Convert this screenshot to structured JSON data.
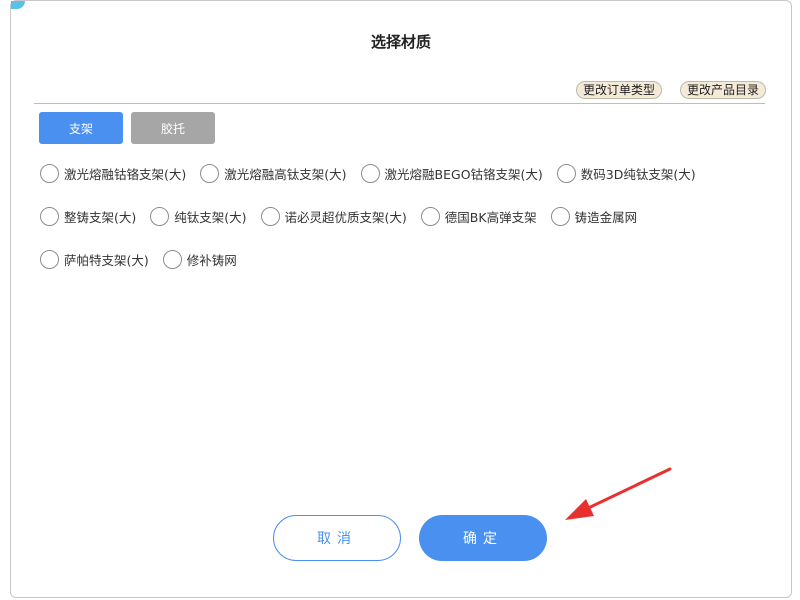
{
  "dialog": {
    "title": "选择材质",
    "top_actions": {
      "change_order_type": "更改订单类型",
      "change_product_catalog": "更改产品目录"
    },
    "tabs": [
      {
        "label": "支架",
        "active": true
      },
      {
        "label": "胶托",
        "active": false
      }
    ],
    "options": [
      "激光熔融钴铬支架(大)",
      "激光熔融高钛支架(大)",
      "激光熔融BEGO钴铬支架(大)",
      "数码3D纯钛支架(大)",
      "整铸支架(大)",
      "纯钛支架(大)",
      "诺必灵超优质支架(大)",
      "德国BK高弹支架",
      "铸造金属网",
      "萨帕特支架(大)",
      "修补铸网"
    ],
    "footer": {
      "cancel_label": "取消",
      "confirm_label": "确定"
    }
  },
  "colors": {
    "primary": "#4a90f0",
    "inactive_tab": "#a6a6a6",
    "pill_bg": "#f5ead8",
    "annotation_arrow": "#e8312f"
  }
}
